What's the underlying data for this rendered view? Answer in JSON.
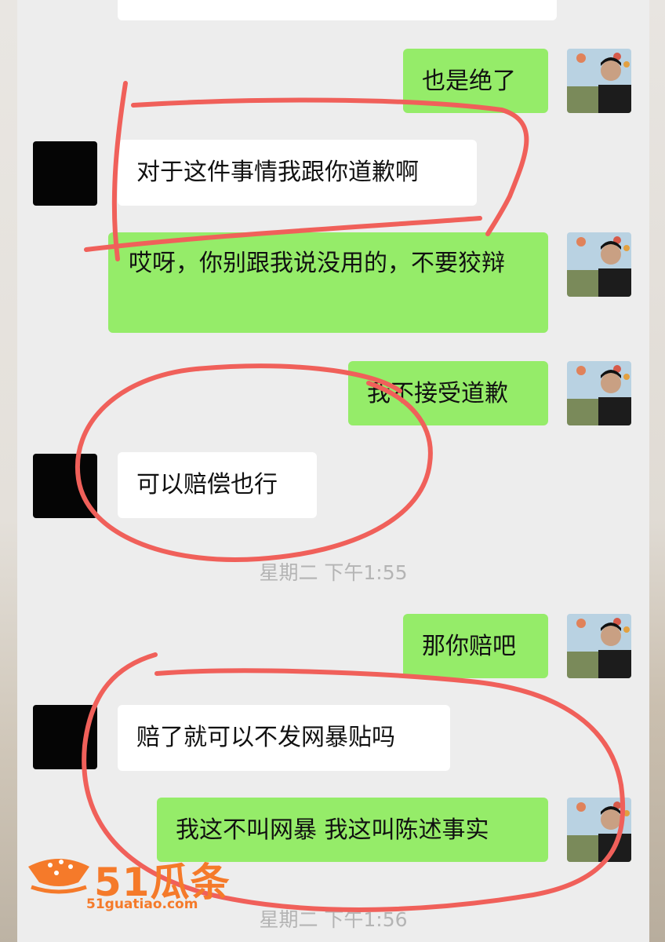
{
  "messages": [
    {
      "side": "out",
      "text": "也是绝了"
    },
    {
      "side": "in",
      "text": "对于这件事情我跟你道歉啊"
    },
    {
      "side": "out",
      "text": "哎呀，你别跟我说没用的，不要狡辩"
    },
    {
      "side": "out",
      "text": "我不接受道歉"
    },
    {
      "side": "in",
      "text": "可以赔偿也行"
    },
    {
      "side": "time",
      "text": "星期二 下午1:55"
    },
    {
      "side": "out",
      "text": "那你赔吧"
    },
    {
      "side": "in",
      "text": "赔了就可以不发网暴贴吗"
    },
    {
      "side": "out",
      "text": "我这不叫网暴 我这叫陈述事实"
    },
    {
      "side": "time",
      "text": "星期二 下午1:56"
    }
  ],
  "watermark": {
    "brand": "51瓜条",
    "url": "51guatiao.com"
  },
  "colors": {
    "incoming": "#ffffff",
    "outgoing": "#95ec69",
    "annotation": "#f0605a",
    "watermark": "#f57a2a"
  }
}
